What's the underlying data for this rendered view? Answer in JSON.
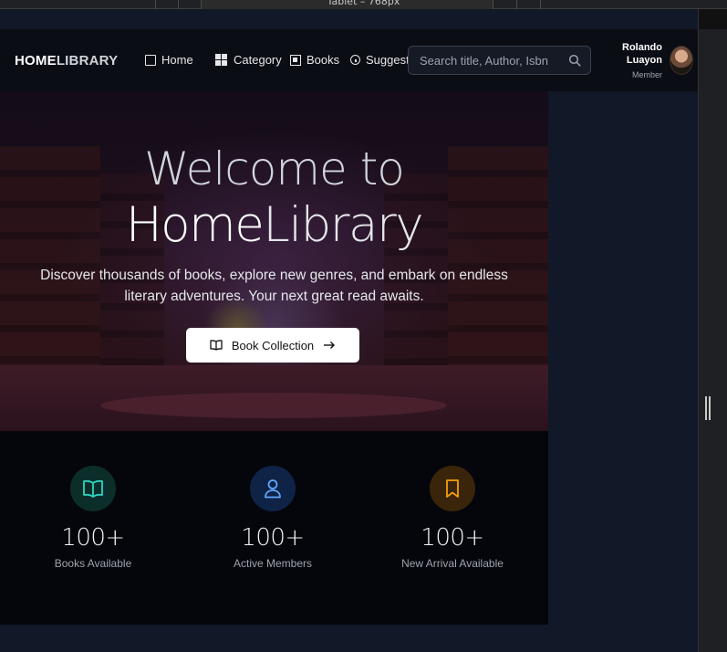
{
  "devtools": {
    "viewport_label": "Tablet – 768px"
  },
  "navbar": {
    "logo_strong": "HOME",
    "logo_rest": "LIBRARY",
    "items": [
      {
        "label": "Home",
        "icon": "home-square-icon"
      },
      {
        "label": "Category",
        "icon": "grid-icon"
      },
      {
        "label": "Books",
        "icon": "book-box-icon"
      },
      {
        "label": "Suggest",
        "icon": "info-icon"
      }
    ],
    "search_placeholder": "Search title, Author, Isbn",
    "user": {
      "name_line1": "Rolando",
      "name_line2": "Luayon",
      "role": "Member"
    }
  },
  "hero": {
    "title_line1": "Welcome to",
    "title_home": "Home",
    "title_library": "Library",
    "subtitle_line1": "Discover thousands of books, explore new genres, and embark on endless",
    "subtitle_line2": "literary adventures. Your next great read awaits.",
    "cta_label": "Book Collection"
  },
  "stats": [
    {
      "value": "100+",
      "label": "Books Available",
      "icon": "open-book-icon",
      "color": "#2dd4bf",
      "bg": "#0c2e2b"
    },
    {
      "value": "100+",
      "label": "Active Members",
      "icon": "user-icon",
      "color": "#60a5fa",
      "bg": "#0f2347"
    },
    {
      "value": "100+",
      "label": "New Arrival Available",
      "icon": "bookmark-icon",
      "color": "#f59e0b",
      "bg": "#3a250a"
    }
  ]
}
